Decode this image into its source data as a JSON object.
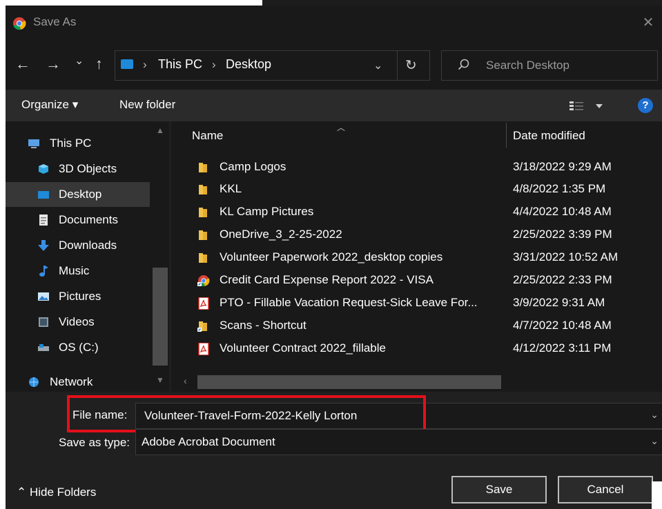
{
  "window": {
    "title": "Save As",
    "close_glyph": "✕"
  },
  "nav": {
    "back_glyph": "←",
    "forward_glyph": "→",
    "recent_glyph": "⌄",
    "up_glyph": "↑",
    "breadcrumb": [
      "This PC",
      "Desktop"
    ],
    "breadcrumb_sep": "›",
    "dropdown_glyph": "⌄",
    "refresh_glyph": "↻"
  },
  "search": {
    "placeholder": "Search Desktop"
  },
  "toolbar": {
    "organize_label": "Organize ▾",
    "new_folder_label": "New folder",
    "help_label": "?"
  },
  "sidebar": {
    "items": [
      {
        "label": "This PC",
        "icon": "computer-icon"
      },
      {
        "label": "3D Objects",
        "icon": "cube-icon"
      },
      {
        "label": "Desktop",
        "icon": "desktop-icon",
        "selected": true
      },
      {
        "label": "Documents",
        "icon": "document-icon"
      },
      {
        "label": "Downloads",
        "icon": "download-icon"
      },
      {
        "label": "Music",
        "icon": "music-icon"
      },
      {
        "label": "Pictures",
        "icon": "pictures-icon"
      },
      {
        "label": "Videos",
        "icon": "videos-icon"
      },
      {
        "label": "OS (C:)",
        "icon": "drive-icon"
      },
      {
        "label": "Network",
        "icon": "network-icon"
      }
    ]
  },
  "files": {
    "columns": {
      "name": "Name",
      "date": "Date modified"
    },
    "rows": [
      {
        "name": "Camp Logos",
        "date": "3/18/2022 9:29 AM",
        "icon": "folder-icon"
      },
      {
        "name": "KKL",
        "date": "4/8/2022 1:35 PM",
        "icon": "folder-icon"
      },
      {
        "name": "KL Camp Pictures",
        "date": "4/4/2022 10:48 AM",
        "icon": "folder-icon"
      },
      {
        "name": "OneDrive_3_2-25-2022",
        "date": "2/25/2022 3:39 PM",
        "icon": "folder-icon"
      },
      {
        "name": "Volunteer Paperwork 2022_desktop copies",
        "date": "3/31/2022 10:52 AM",
        "icon": "folder-icon"
      },
      {
        "name": "Credit Card Expense Report 2022 - VISA",
        "date": "2/25/2022 2:33 PM",
        "icon": "chrome-shortcut-icon"
      },
      {
        "name": "PTO - Fillable Vacation Request-Sick Leave For...",
        "date": "3/9/2022 9:31 AM",
        "icon": "pdf-icon"
      },
      {
        "name": "Scans - Shortcut",
        "date": "4/7/2022 10:48 AM",
        "icon": "folder-shortcut-icon"
      },
      {
        "name": "Volunteer Contract 2022_fillable",
        "date": "4/12/2022 3:11 PM",
        "icon": "pdf-icon"
      }
    ]
  },
  "form": {
    "filename_label": "File name:",
    "filename_value": "Volunteer-Travel-Form-2022-Kelly Lorton",
    "type_label": "Save as type:",
    "type_value": "Adobe Acrobat Document",
    "hide_folders_label": "⌃  Hide Folders",
    "save_label": "Save",
    "cancel_label": "Cancel"
  },
  "colors": {
    "highlight": "#e3101a",
    "folder": "#f0c24a",
    "selection": "#373737",
    "accent": "#1f6fd0"
  }
}
